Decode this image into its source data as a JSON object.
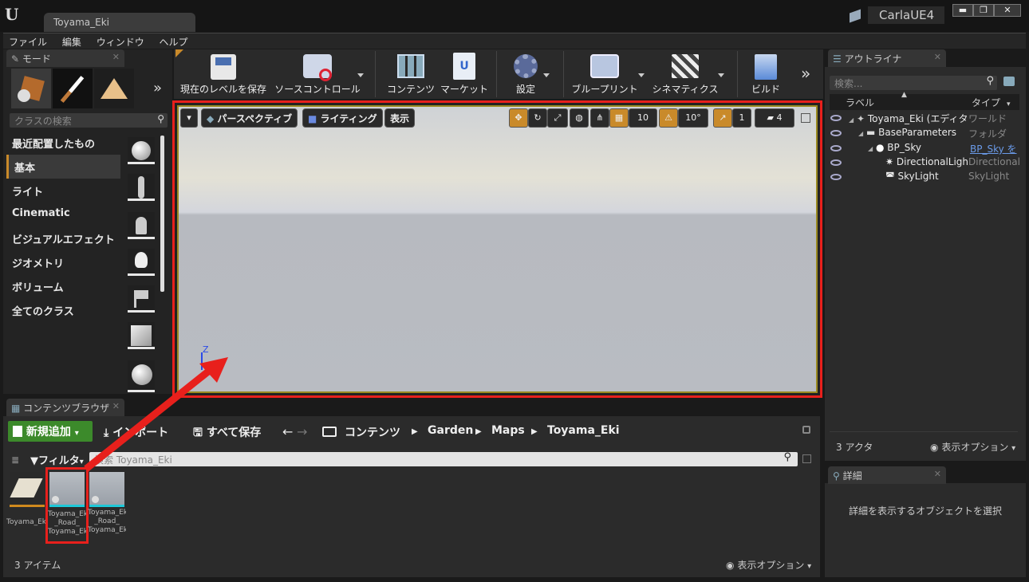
{
  "window": {
    "tab_title": "Toyama_Eki",
    "project_name": "CarlaUE4",
    "minimize": "▬",
    "maximize": "❐",
    "close": "✕"
  },
  "menu": [
    "ファイル",
    "編集",
    "ウィンドウ",
    "ヘルプ"
  ],
  "modes": {
    "tab_label": "モード",
    "search_placeholder": "クラスの検索",
    "categories": [
      "最近配置したもの",
      "基本",
      "ライト",
      "Cinematic",
      "ビジュアルエフェクト",
      "ジオメトリ",
      "ボリューム",
      "全てのクラス"
    ],
    "selected_index": 1
  },
  "toolbar": {
    "save_level": "現在のレベルを保存",
    "source_control": "ソースコントロール",
    "content": "コンテンツ",
    "market": "マーケット",
    "settings": "設定",
    "blueprint": "ブループリント",
    "cinematics": "シネマティクス",
    "build": "ビルド"
  },
  "viewport": {
    "perspective": "パースペクティブ",
    "lighting": "ライティング",
    "show": "表示",
    "grid_snap": "10",
    "rot_snap": "10°",
    "scale_snap": "1",
    "cam_speed": "4",
    "axis_z": "Z"
  },
  "content_browser": {
    "tab_label": "コンテンツブラウザ",
    "add_new": "新規追加",
    "import": "インポート",
    "save_all": "すべて保存",
    "breadcrumb": [
      "コンテンツ",
      "Garden",
      "Maps",
      "Toyama_Eki"
    ],
    "filter": "フィルタ",
    "search_placeholder": "検索 Toyama_Eki",
    "item_count": "3 アイテム",
    "view_options": "表示オプション",
    "assets": [
      {
        "name": "Toyama_Eki"
      },
      {
        "name": "Toyama_Eki _Road_ Toyama_Eki"
      },
      {
        "name": "Toyama_Eki _Road_ Toyama_Eki"
      }
    ]
  },
  "outliner": {
    "tab_label": "アウトライナ",
    "search_placeholder": "検索...",
    "col_label": "ラベル",
    "col_type": "タイプ",
    "rows": [
      {
        "label": "Toyama_Eki (エディタ)",
        "type": "ワールド"
      },
      {
        "label": "BaseParameters",
        "type": "フォルダ"
      },
      {
        "label": "BP_Sky",
        "type": "BP_Sky を"
      },
      {
        "label": "DirectionalLigh",
        "type": "DirectionalL"
      },
      {
        "label": "SkyLight",
        "type": "SkyLight"
      }
    ],
    "actor_count": "3 アクタ",
    "view_options": "表示オプション"
  },
  "details": {
    "tab_label": "詳細",
    "empty_message": "詳細を表示するオブジェクトを選択"
  },
  "colors": {
    "highlight_red": "#e8201c",
    "green_button": "#3c8a2b",
    "accent_orange": "#c98a2a"
  }
}
